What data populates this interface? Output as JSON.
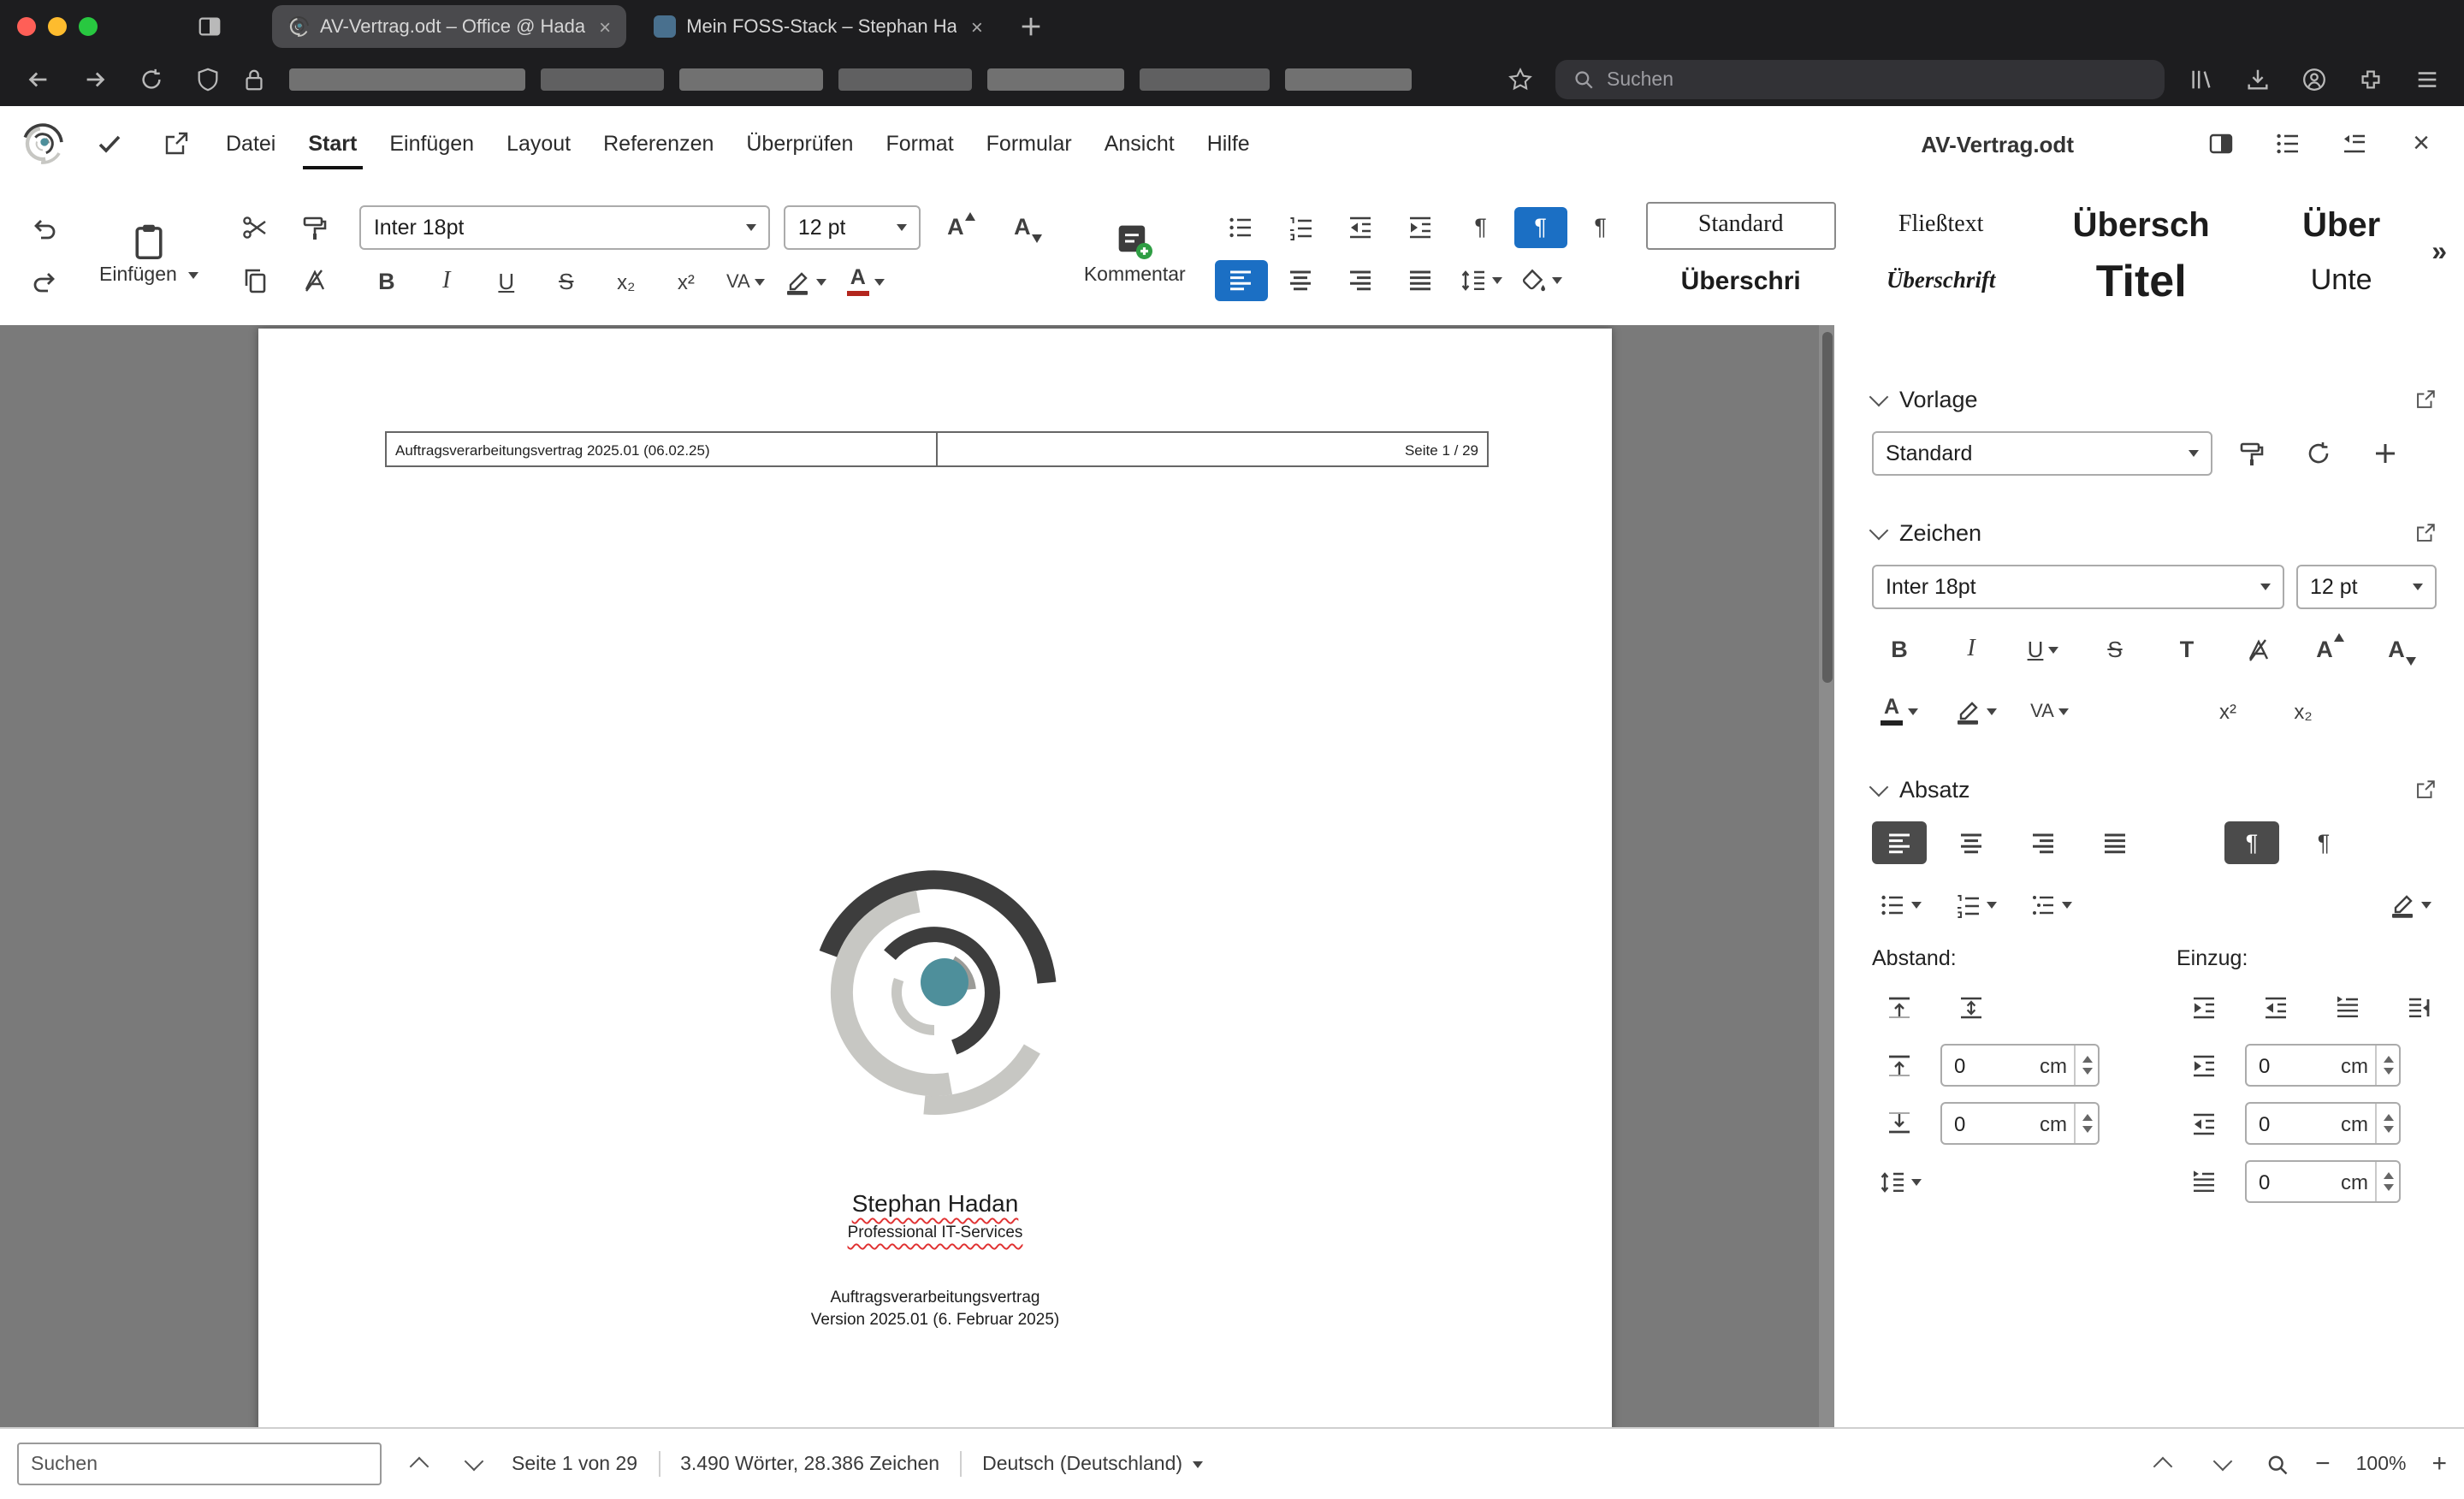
{
  "browser": {
    "tab1": "AV-Vertrag.odt – Office @ Hada",
    "tab2": "Mein FOSS-Stack – Stephan Ha",
    "search_placeholder": "Suchen"
  },
  "appbar": {
    "menus": [
      "Datei",
      "Start",
      "Einfügen",
      "Layout",
      "Referenzen",
      "Überprüfen",
      "Format",
      "Formular",
      "Ansicht",
      "Hilfe"
    ],
    "doc_title": "AV-Vertrag.odt"
  },
  "toolbar": {
    "paste_label": "Einfügen",
    "font_name": "Inter 18pt",
    "font_size": "12 pt",
    "bold": "B",
    "italic": "I",
    "underline": "U",
    "strike": "S",
    "subscript": "x₂",
    "superscript": "x²",
    "spacing": "VA",
    "font_color": "A",
    "grow": "A",
    "shrink": "A",
    "pilcrow": "¶",
    "comment_label": "Kommentar",
    "styles": [
      "Standard",
      "Fließtext",
      "Übersch",
      "Über",
      "Überschri",
      "Überschrift",
      "Titel",
      "Unte"
    ],
    "more": "»"
  },
  "sidebar": {
    "vorlage_title": "Vorlage",
    "vorlage_style": "Standard",
    "zeichen_title": "Zeichen",
    "font_name": "Inter 18pt",
    "font_size": "12 pt",
    "absatz_title": "Absatz",
    "abstand_label": "Abstand:",
    "einzug_label": "Einzug:",
    "val": "0",
    "unit": "cm"
  },
  "document": {
    "header_left": "Auftragsverarbeitungsvertrag 2025.01 (06.02.25)",
    "header_right": "Seite 1 / 29",
    "name": "Stephan Hadan",
    "subtitle": "Professional IT-Services",
    "line1": "Auftragsverarbeitungsvertrag",
    "line2": "Version 2025.01 (6. Februar 2025)"
  },
  "statusbar": {
    "search_placeholder": "Suchen",
    "page": "Seite 1 von 29",
    "words": "3.490 Wörter, 28.386 Zeichen",
    "language": "Deutsch (Deutschland)",
    "zoom": "100%"
  },
  "colors": {
    "accent": "#1b6fc4",
    "teal": "#4e8f9b",
    "comment_green": "#2f9e44"
  }
}
